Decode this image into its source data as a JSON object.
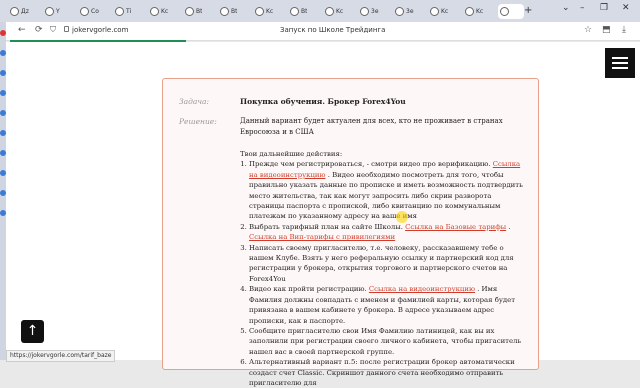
{
  "browser": {
    "tabs": [
      {
        "label": "Дz",
        "active": false
      },
      {
        "label": "Y",
        "active": false
      },
      {
        "label": "Co",
        "active": false
      },
      {
        "label": "Ti",
        "active": false
      },
      {
        "label": "Kc",
        "active": false
      },
      {
        "label": "Bt",
        "active": false
      },
      {
        "label": "Bt",
        "active": false
      },
      {
        "label": "Kc",
        "active": false
      },
      {
        "label": "Bt",
        "active": false
      },
      {
        "label": "Kc",
        "active": false
      },
      {
        "label": "3e",
        "active": false
      },
      {
        "label": "3e",
        "active": false
      },
      {
        "label": "Kc",
        "active": false
      },
      {
        "label": "Kc",
        "active": false
      },
      {
        "label": "",
        "active": true
      }
    ],
    "new_tab": "+",
    "url": "jokervgorle.com",
    "page_title": "Запуск по Школе Трейдинга",
    "status_url": "https://jokervgorle.com/tarif_baze"
  },
  "content": {
    "task_label": "Задача:",
    "task_value": "Покупка обучения. Брокер Forex4You",
    "solution_label": "Решение:",
    "solution_intro": "Данный вариант будет актуален для всех, кто не проживает в странах Евросоюза и в США",
    "steps_header": "Твои дальнейшие действия:",
    "step1_text": "Прежде чем регистрироваться, - смотри видео про верификацию.",
    "step1_link": "Ссылка на видеоинструкцию",
    "step1_rest": ". Видео необходимо посмотреть для того, чтобы правильно указать данные по прописке и иметь возможность подтвердить место жительства, так как могут запросить либо скрин разворота страницы паспорта с пропиской, либо квитанцию по коммунальным платежам по указанному адресу на ваше имя",
    "step2_text": "Выбрать тарифный план на сайте Школы.",
    "step2_link1": "Ссылка на Базовые тарифы",
    "step2_sep": ".",
    "step2_link2": "Ссылка на Вип-тарифы с привилегиями",
    "step3_text": "Написать своему пригласителю, т.е. человеку, рассказавшему тебе о нашем Клубе. Взять у него реферальную ссылку и партнерский код для регистрации у брокера, открытия торгового и партнерского счетов на Forex4You",
    "step4_text": "Видео как пройти регистрацию.",
    "step4_link": "Ссылка на видеоинструкцию",
    "step4_rest": ". Имя Фамилия должны совпадать с именем и фамилией карты, которая будет привязана в вашем кабинете у брокера. В адресе указываем адрес прописки, как в паспорте.",
    "step5_text": "Сообщите пригласителю свои Имя Фамилию латиницей, как вы их заполнили при регистрации своего личного кабинета, чтобы пригаситель нашел вас в своей партнерской группе.",
    "step6_text": "Альтернативный вариант п.5: после регистрации брокер автоматически создаст счет Classic. Скриншот данного счета необходимо отправить пригласителю для"
  },
  "icons": {
    "back": "back-arrow-icon",
    "forward": "forward-arrow-icon",
    "refresh": "refresh-icon",
    "menu": "hamburger-menu-icon",
    "up": "arrow-up-icon"
  },
  "colors": {
    "link": "#d23c2a",
    "card_border": "#e6a08c",
    "progress": "#1f8f55"
  }
}
